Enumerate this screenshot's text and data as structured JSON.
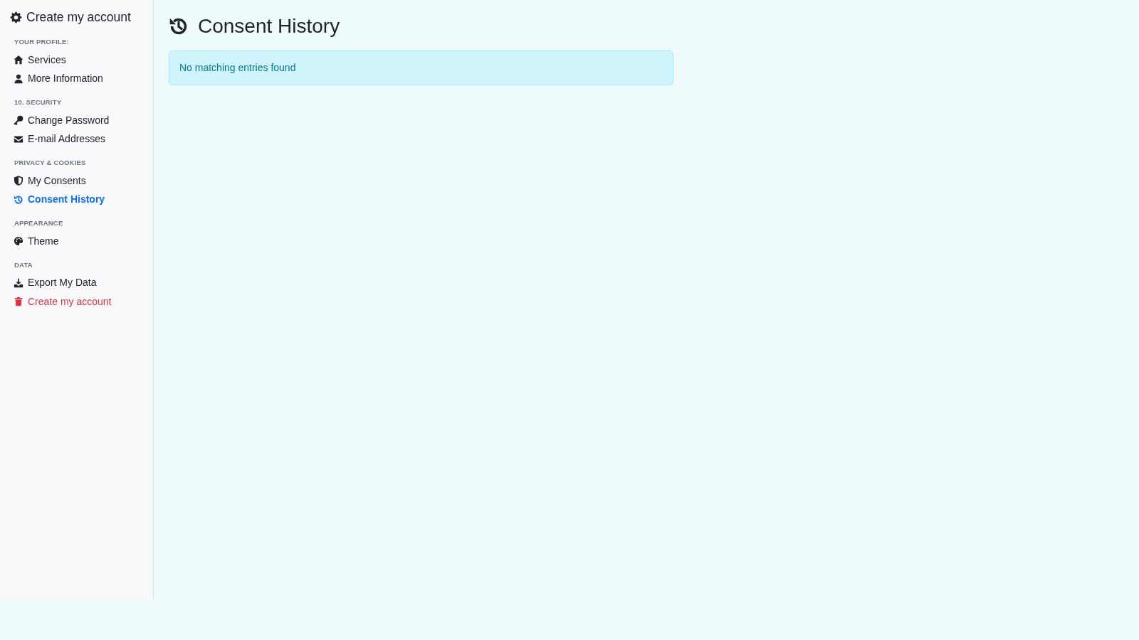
{
  "sidebar": {
    "title": "Create my account",
    "sections": [
      {
        "heading": "YOUR PROFILE:",
        "items": [
          {
            "label": "Services",
            "kind": "link",
            "selected": false
          },
          {
            "label": "More Information",
            "kind": "link",
            "selected": false
          }
        ]
      },
      {
        "heading": "10. SECURITY",
        "items": [
          {
            "label": "Change Password",
            "kind": "link",
            "selected": false
          },
          {
            "label": "E-mail Addresses",
            "kind": "link",
            "selected": false
          }
        ]
      },
      {
        "heading": "PRIVACY & COOKIES",
        "items": [
          {
            "label": "My Consents",
            "kind": "link",
            "selected": false
          },
          {
            "label": "Consent History",
            "kind": "link",
            "selected": true
          }
        ]
      },
      {
        "heading": "APPEARANCE",
        "items": [
          {
            "label": "Theme",
            "kind": "link",
            "selected": false
          }
        ]
      },
      {
        "heading": "DATA",
        "items": [
          {
            "label": "Export My Data",
            "kind": "link",
            "selected": false
          },
          {
            "label": "Create my account",
            "kind": "danger",
            "selected": false
          }
        ]
      }
    ]
  },
  "main": {
    "title": "Consent History",
    "alert": "No matching entries found"
  }
}
